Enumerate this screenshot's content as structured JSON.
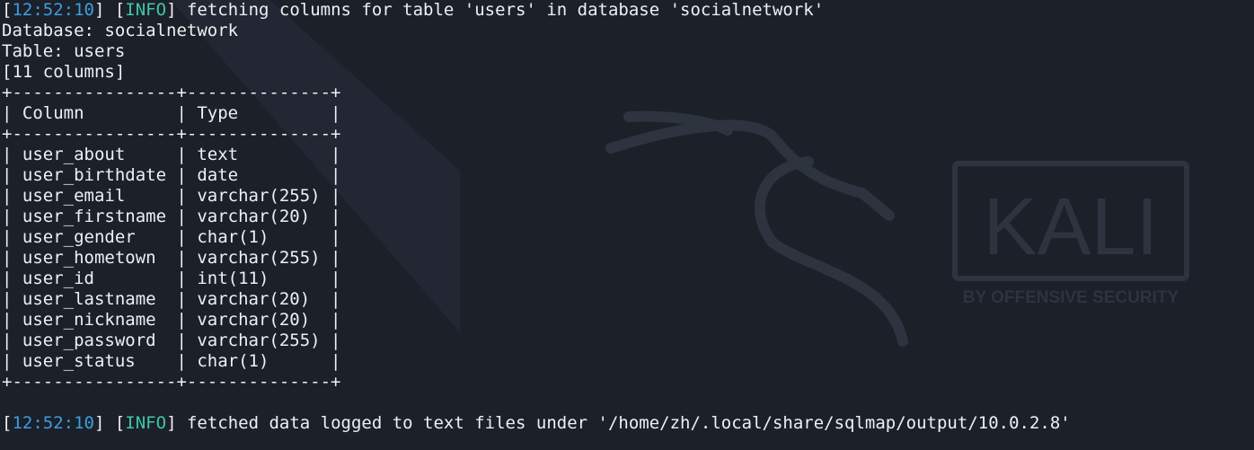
{
  "log": {
    "first": {
      "timestamp": "12:52:10",
      "level": "INFO",
      "message": "fetching columns for table 'users' in database 'socialnetwork'"
    },
    "last": {
      "timestamp": "12:52:10",
      "level": "INFO",
      "message": "fetched data logged to text files under '/home/zh/.local/share/sqlmap/output/10.0.2.8'"
    }
  },
  "meta": {
    "database": "Database: socialnetwork",
    "table": "Table: users",
    "columns_count": "[11 columns]"
  },
  "table": {
    "border": "+----------------+--------------+",
    "header": "| Column         | Type         |",
    "rows": [
      "| user_about     | text         |",
      "| user_birthdate | date         |",
      "| user_email     | varchar(255) |",
      "| user_firstname | varchar(20)  |",
      "| user_gender    | char(1)      |",
      "| user_hometown  | varchar(255) |",
      "| user_id        | int(11)      |",
      "| user_lastname  | varchar(20)  |",
      "| user_nickname  | varchar(20)  |",
      "| user_password  | varchar(255) |",
      "| user_status    | char(1)      |"
    ]
  },
  "wallpaper": {
    "logo_text": "KALI",
    "tagline": "BY OFFENSIVE SECURITY"
  },
  "colors": {
    "background": "#1c2028",
    "text": "#eef0f2",
    "timestamp": "#3d9ee0",
    "level": "#3cc8a8"
  }
}
